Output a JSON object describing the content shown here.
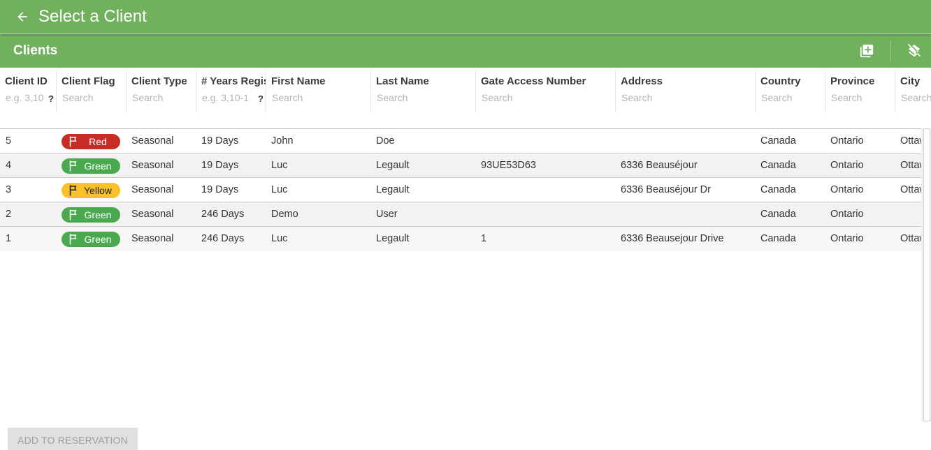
{
  "header": {
    "title": "Select a Client"
  },
  "subheader": {
    "title": "Clients",
    "actions": [
      "add-client-icon",
      "layers-off-icon"
    ]
  },
  "columns": [
    {
      "title": "Client ID",
      "placeholder": "e.g. 3,10",
      "help": "?"
    },
    {
      "title": "Client Flag",
      "placeholder": "Search"
    },
    {
      "title": "Client Type",
      "placeholder": "Search"
    },
    {
      "title": "# Years Registered",
      "placeholder": "e.g. 3,10-1",
      "help": "?"
    },
    {
      "title": "First Name",
      "placeholder": "Search"
    },
    {
      "title": "Last Name",
      "placeholder": "Search"
    },
    {
      "title": "Gate Access Number",
      "placeholder": "Search"
    },
    {
      "title": "Address",
      "placeholder": "Search"
    },
    {
      "title": "Country",
      "placeholder": "Search"
    },
    {
      "title": "Province",
      "placeholder": "Search"
    },
    {
      "title": "City",
      "placeholder": "Search"
    }
  ],
  "rows": [
    {
      "id": "5",
      "flag": "Red",
      "type": "Seasonal",
      "years": "19 Days",
      "first": "John",
      "last": "Doe",
      "gate": "",
      "address": "",
      "country": "Canada",
      "province": "Ontario",
      "city": "Ottawa"
    },
    {
      "id": "4",
      "flag": "Green",
      "type": "Seasonal",
      "years": "19 Days",
      "first": "Luc",
      "last": "Legault",
      "gate": "93UE53D63",
      "address": "6336 Beauséjour",
      "country": "Canada",
      "province": "Ontario",
      "city": "Ottawa"
    },
    {
      "id": "3",
      "flag": "Yellow",
      "type": "Seasonal",
      "years": "19 Days",
      "first": "Luc",
      "last": "Legault",
      "gate": "",
      "address": "6336 Beauséjour Dr",
      "country": "Canada",
      "province": "Ontario",
      "city": "Ottawa"
    },
    {
      "id": "2",
      "flag": "Green",
      "type": "Seasonal",
      "years": "246 Days",
      "first": "Demo",
      "last": "User",
      "gate": "",
      "address": "",
      "country": "Canada",
      "province": "Ontario",
      "city": ""
    },
    {
      "id": "1",
      "flag": "Green",
      "type": "Seasonal",
      "years": "246 Days",
      "first": "Luc",
      "last": "Legault",
      "gate": "1",
      "address": "6336 Beausejour Drive",
      "country": "Canada",
      "province": "Ontario",
      "city": "Ottawa"
    }
  ],
  "flag_colors": {
    "Red": "#c62b26",
    "Green": "#4aa94f",
    "Yellow": "#f8c12b"
  },
  "accent_color": "#71b15d",
  "footer": {
    "add_button": "ADD TO RESERVATION"
  }
}
